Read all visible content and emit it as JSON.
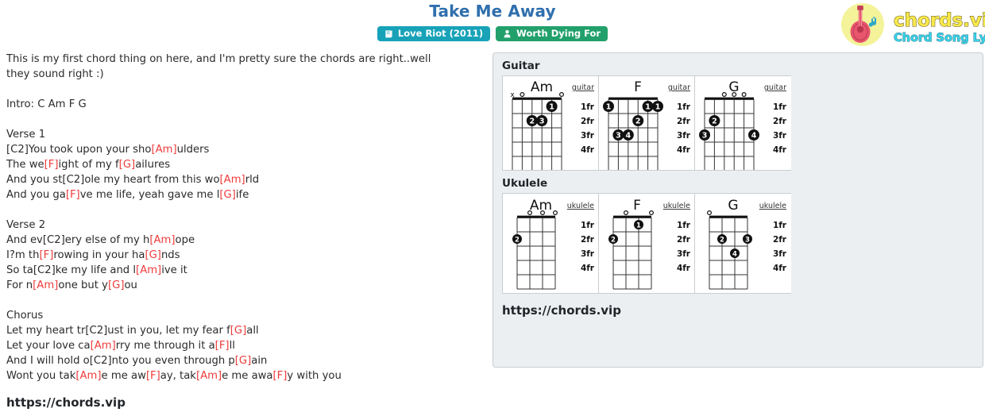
{
  "header": {
    "title": "Take Me Away",
    "badges": [
      {
        "label": "Love Riot (2011)",
        "icon": "album-icon",
        "color": "#17a2b8"
      },
      {
        "label": "Worth Dying For",
        "icon": "artist-icon",
        "color": "#22a06b"
      }
    ]
  },
  "logo": {
    "brand": "chords.vip",
    "tagline": "Chord Song Lyric",
    "icon": "guitar-icon",
    "brand_color": "#f7e94a",
    "tagline_color": "#39d3e8",
    "circle_color": "#f4f39a"
  },
  "lyrics": {
    "text": "This is my first chord thing on here, and I'm pretty sure the chords are right..well\nthey sound right :)\n\nIntro: C Am F G\n\nVerse 1\n[C2]You took upon your sho[Am]ulders\nThe we[F]ight of my f[G]ailures\nAnd you st[C2]ole my heart from this wo[Am]rld\nAnd you ga[F]ve me life, yeah gave me l[G]ife\n\nVerse 2\nAnd ev[C2]ery else of my h[Am]ope\nI?m th[F]rowing in your ha[G]nds\nSo ta[C2]ke my life and l[Am]ive it\nFor n[Am]one but y[G]ou\n\nChorus\nLet my heart tr[C2]ust in you, let my fear f[G]all\nLet your love ca[Am]rry me through it a[F]ll\nAnd I will hold o[C2]nto you even through p[G]ain\nWont you tak[Am]e me aw[F]ay, tak[Am]e me awa[F]y with you",
    "chord_color": "#ef3b3b"
  },
  "site_url": "https://chords.vip",
  "chord_panel": {
    "sections": [
      {
        "title": "Guitar",
        "instrument_label": "guitar",
        "strings": 6,
        "fret_labels": [
          "1fr",
          "2fr",
          "3fr",
          "4fr"
        ],
        "chords": [
          {
            "name": "Am",
            "open_markers": [
              "x",
              "o",
              "",
              "",
              "",
              "o"
            ],
            "dots": [
              {
                "string": 5,
                "fret": 1,
                "finger": "1"
              },
              {
                "string": 3,
                "fret": 2,
                "finger": "2"
              },
              {
                "string": 4,
                "fret": 2,
                "finger": "3"
              }
            ]
          },
          {
            "name": "F",
            "open_markers": [
              "",
              "",
              "",
              "",
              "",
              ""
            ],
            "dots": [
              {
                "string": 1,
                "fret": 1,
                "finger": "1"
              },
              {
                "string": 5,
                "fret": 1,
                "finger": "1"
              },
              {
                "string": 6,
                "fret": 1,
                "finger": "1"
              },
              {
                "string": 4,
                "fret": 2,
                "finger": "2"
              },
              {
                "string": 2,
                "fret": 3,
                "finger": "3"
              },
              {
                "string": 3,
                "fret": 3,
                "finger": "4"
              }
            ]
          },
          {
            "name": "G",
            "open_markers": [
              "",
              "",
              "o",
              "o",
              "o",
              ""
            ],
            "dots": [
              {
                "string": 2,
                "fret": 2,
                "finger": "2"
              },
              {
                "string": 1,
                "fret": 3,
                "finger": "3"
              },
              {
                "string": 6,
                "fret": 3,
                "finger": "4"
              }
            ]
          }
        ]
      },
      {
        "title": "Ukulele",
        "instrument_label": "ukulele",
        "strings": 4,
        "fret_labels": [
          "1fr",
          "2fr",
          "3fr",
          "4fr"
        ],
        "chords": [
          {
            "name": "Am",
            "open_markers": [
              "",
              "o",
              "o",
              "o"
            ],
            "dots": [
              {
                "string": 1,
                "fret": 2,
                "finger": "2"
              }
            ]
          },
          {
            "name": "F",
            "open_markers": [
              "",
              "o",
              "",
              "o"
            ],
            "dots": [
              {
                "string": 3,
                "fret": 1,
                "finger": "1"
              },
              {
                "string": 1,
                "fret": 2,
                "finger": "2"
              }
            ]
          },
          {
            "name": "G",
            "open_markers": [
              "o",
              "",
              "",
              ""
            ],
            "dots": [
              {
                "string": 2,
                "fret": 2,
                "finger": "2"
              },
              {
                "string": 4,
                "fret": 2,
                "finger": "3"
              },
              {
                "string": 3,
                "fret": 3,
                "finger": "4"
              }
            ]
          }
        ]
      }
    ]
  }
}
